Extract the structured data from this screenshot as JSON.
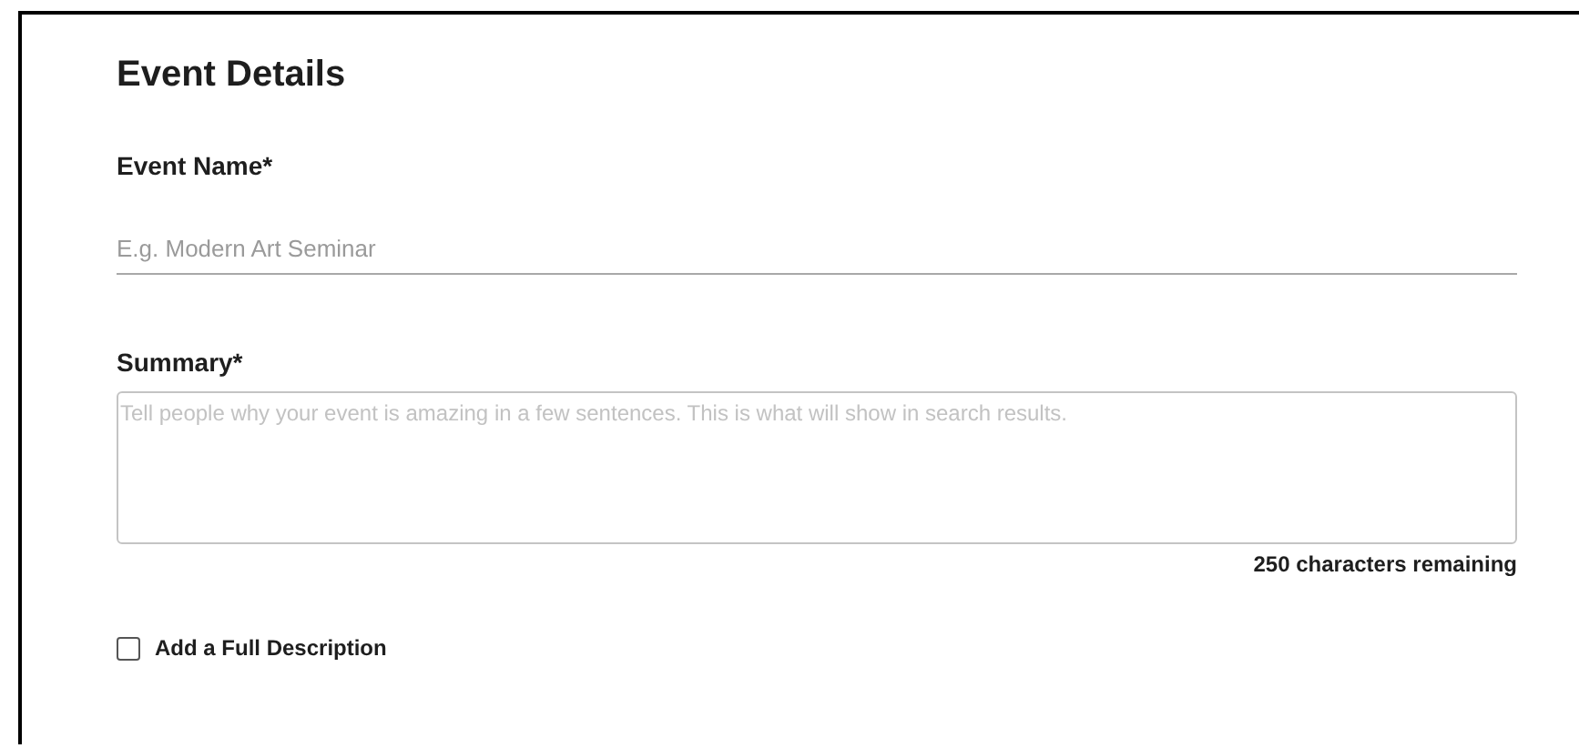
{
  "section": {
    "title": "Event Details"
  },
  "event_name": {
    "label": "Event Name*",
    "placeholder": "E.g. Modern Art Seminar"
  },
  "summary": {
    "label": "Summary*",
    "placeholder": "Tell people why your event is amazing in a few sentences. This is what will show in search results.",
    "counter": "250 characters remaining"
  },
  "full_description": {
    "label": "Add a Full Description",
    "checked": false
  }
}
